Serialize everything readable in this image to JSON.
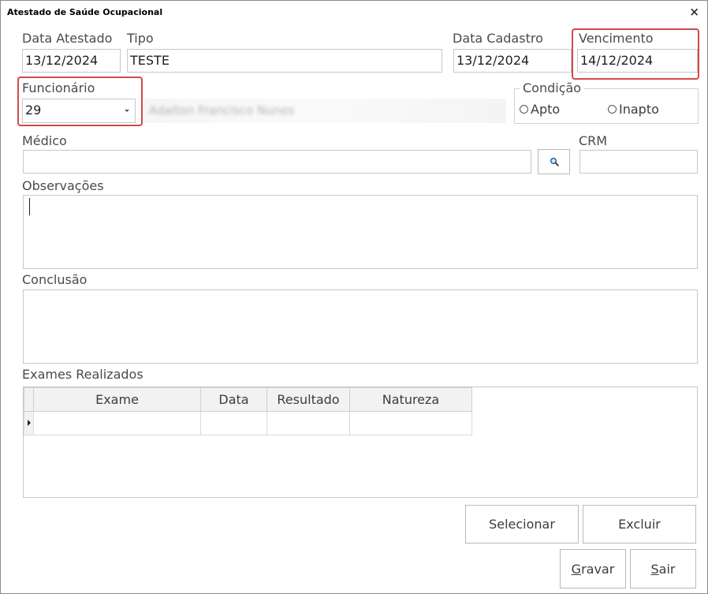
{
  "window": {
    "title": "Atestado de Saúde Ocupacional",
    "close_glyph": "×"
  },
  "labels": {
    "data_atestado": "Data Atestado",
    "tipo": "Tipo",
    "data_cadastro": "Data Cadastro",
    "vencimento": "Vencimento",
    "funcionario": "Funcionário",
    "condicao": "Condição",
    "medico": "Médico",
    "crm": "CRM",
    "observacoes": "Observações",
    "conclusao": "Conclusão",
    "exames_realizados": "Exames Realizados"
  },
  "fields": {
    "data_atestado": "13/12/2024",
    "tipo": "TESTE",
    "data_cadastro": "13/12/2024",
    "vencimento": "14/12/2024",
    "funcionario_code": "29",
    "funcionario_name": "Adalton Francisco Nunes",
    "medico": "",
    "crm": ""
  },
  "condicao": {
    "options": [
      "Apto",
      "Inapto"
    ],
    "selected": null
  },
  "exames_table": {
    "columns": [
      "Exame",
      "Data",
      "Resultado",
      "Natureza"
    ],
    "rows": [
      [
        "",
        "",
        "",
        ""
      ]
    ]
  },
  "buttons": {
    "selecionar": "Selecionar",
    "excluir": "Excluir",
    "gravar_mnemonic": "G",
    "gravar_rest": "ravar",
    "sair_mnemonic": "S",
    "sair_rest": "air"
  },
  "icons": {
    "search": "magnifier-icon",
    "close": "close-icon",
    "dropdown": "chevron-down-icon",
    "row_indicator": "row-arrow-icon"
  },
  "colors": {
    "highlight": "#d04a4a",
    "border": "#c8c8c8",
    "header_bg": "#f2f2f2"
  }
}
